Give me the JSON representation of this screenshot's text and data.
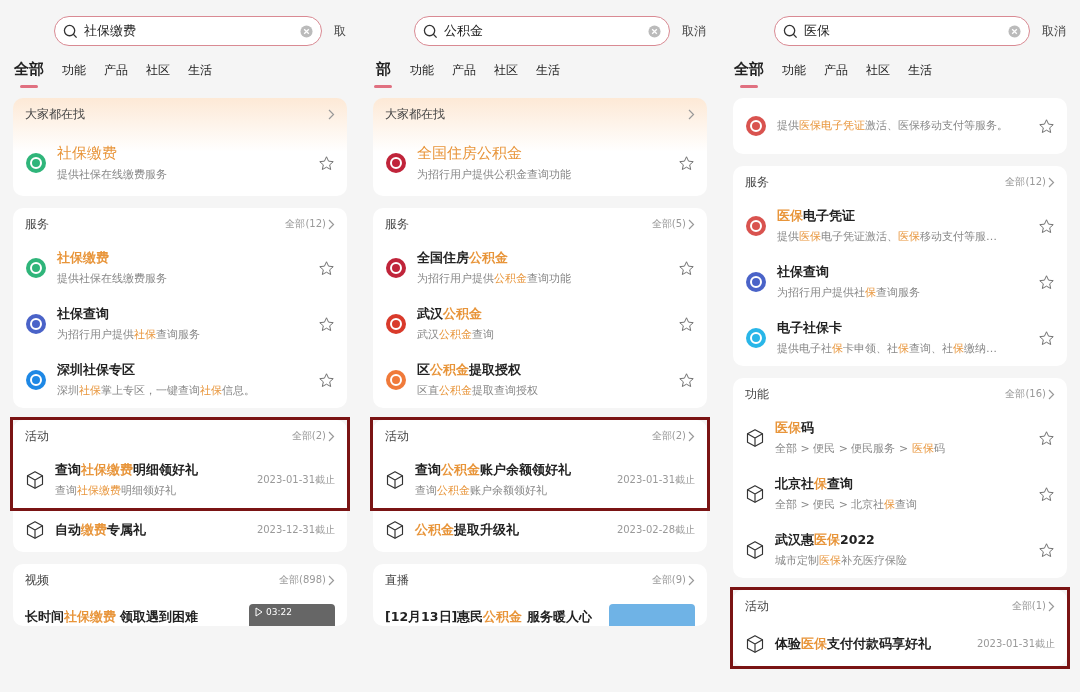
{
  "panels": [
    {
      "search": {
        "value": "社保缴费"
      },
      "cancel": "取",
      "tabs": [
        {
          "label": "全部",
          "selected": true
        },
        {
          "label": "功能",
          "selected": false
        },
        {
          "label": "产品",
          "selected": false
        },
        {
          "label": "社区",
          "selected": false
        },
        {
          "label": "生活",
          "selected": false
        }
      ],
      "sections": [
        {
          "kind": "featured",
          "header": "大家都在找",
          "boxed": false,
          "rows": [
            {
              "kind": "service",
              "color": "#2fb57a",
              "title": [
                {
                  "t": "社保缴费",
                  "highlight": true
                }
              ],
              "desc": [
                {
                  "t": "提供社保在线缴费服务",
                  "highlight": false
                }
              ]
            }
          ]
        },
        {
          "kind": "list",
          "header": "服务",
          "more": "全部(12)",
          "boxed": false,
          "rows": [
            {
              "kind": "service",
              "color": "#2fb57a",
              "title": [
                {
                  "t": "社保缴费",
                  "highlight": true
                }
              ],
              "desc": [
                {
                  "t": "提供社保在线缴费服务",
                  "highlight": false
                }
              ]
            },
            {
              "kind": "service",
              "color": "#4a63c8",
              "title": [
                {
                  "t": "社保查询",
                  "highlight": false
                }
              ],
              "desc": [
                {
                  "t": "为招行用户提供",
                  "highlight": false
                },
                {
                  "t": "社保",
                  "highlight": true
                },
                {
                  "t": "查询服务",
                  "highlight": false
                }
              ]
            },
            {
              "kind": "service",
              "color": "#1e88e5",
              "title": [
                {
                  "t": "深圳社保专区",
                  "highlight": false
                }
              ],
              "desc": [
                {
                  "t": "深圳",
                  "highlight": false
                },
                {
                  "t": "社保",
                  "highlight": true
                },
                {
                  "t": "掌上专区，一键查询",
                  "highlight": false
                },
                {
                  "t": "社保",
                  "highlight": true
                },
                {
                  "t": "信息。",
                  "highlight": false
                }
              ]
            }
          ]
        },
        {
          "kind": "list",
          "header": "活动",
          "more": "全部(2)",
          "boxed": true,
          "rows": [
            {
              "kind": "activity",
              "boxed": true,
              "date": "2023-01-31截止",
              "title": [
                {
                  "t": "查询",
                  "highlight": false
                },
                {
                  "t": "社保缴费",
                  "highlight": true
                },
                {
                  "t": "明细领好礼",
                  "highlight": false
                }
              ],
              "desc": [
                {
                  "t": "查询",
                  "highlight": false
                },
                {
                  "t": "社保缴费",
                  "highlight": true
                },
                {
                  "t": "明细领好礼",
                  "highlight": false
                }
              ]
            },
            {
              "kind": "activity",
              "boxed": false,
              "date": "2023-12-31截止",
              "title": [
                {
                  "t": "自动",
                  "highlight": false
                },
                {
                  "t": "缴费",
                  "highlight": true
                },
                {
                  "t": "专属礼",
                  "highlight": false
                }
              ]
            }
          ]
        },
        {
          "kind": "list",
          "header": "视频",
          "more": "全部(898)",
          "boxed": false,
          "rows": [
            {
              "kind": "media",
              "duration": "03:22",
              "title": [
                {
                  "t": "长时间",
                  "highlight": false
                },
                {
                  "t": "社保缴费",
                  "highlight": true
                },
                {
                  "t": " 领取遇到困难",
                  "highlight": false
                }
              ]
            }
          ]
        }
      ]
    },
    {
      "search": {
        "value": "公积金"
      },
      "cancel": "取消",
      "tabs": [
        {
          "label": "部",
          "selected": true
        },
        {
          "label": "功能",
          "selected": false
        },
        {
          "label": "产品",
          "selected": false
        },
        {
          "label": "社区",
          "selected": false
        },
        {
          "label": "生活",
          "selected": false
        }
      ],
      "sections": [
        {
          "kind": "featured",
          "header": "大家都在找",
          "boxed": false,
          "rows": [
            {
              "kind": "service",
              "color": "#c0243a",
              "title": [
                {
                  "t": "全国住房公积金",
                  "highlight": true
                }
              ],
              "desc": [
                {
                  "t": "为招行用户提供公积金查询功能",
                  "highlight": false
                }
              ]
            }
          ]
        },
        {
          "kind": "list",
          "header": "服务",
          "more": "全部(5)",
          "boxed": false,
          "rows": [
            {
              "kind": "service",
              "color": "#c0243a",
              "title": [
                {
                  "t": "全国住房",
                  "highlight": false
                },
                {
                  "t": "公积金",
                  "highlight": true
                }
              ],
              "desc": [
                {
                  "t": "为招行用户提供",
                  "highlight": false
                },
                {
                  "t": "公积金",
                  "highlight": true
                },
                {
                  "t": "查询功能",
                  "highlight": false
                }
              ]
            },
            {
              "kind": "service",
              "color": "#d93a2b",
              "title": [
                {
                  "t": "武汉",
                  "highlight": false
                },
                {
                  "t": "公积金",
                  "highlight": true
                }
              ],
              "desc": [
                {
                  "t": "武汉",
                  "highlight": false
                },
                {
                  "t": "公积金",
                  "highlight": true
                },
                {
                  "t": "查询",
                  "highlight": false
                }
              ]
            },
            {
              "kind": "service",
              "color": "#f07a3a",
              "title": [
                {
                  "t": "区",
                  "highlight": false
                },
                {
                  "t": "公积金",
                  "highlight": true
                },
                {
                  "t": "提取授权",
                  "highlight": false
                }
              ],
              "desc": [
                {
                  "t": "区直",
                  "highlight": false
                },
                {
                  "t": "公积金",
                  "highlight": true
                },
                {
                  "t": "提取查询授权",
                  "highlight": false
                }
              ]
            }
          ]
        },
        {
          "kind": "list",
          "header": "活动",
          "more": "全部(2)",
          "boxed": true,
          "rows": [
            {
              "kind": "activity",
              "boxed": true,
              "date": "2023-01-31截止",
              "title": [
                {
                  "t": "查询",
                  "highlight": false
                },
                {
                  "t": "公积金",
                  "highlight": true
                },
                {
                  "t": "账户余额领好礼",
                  "highlight": false
                }
              ],
              "desc": [
                {
                  "t": "查询",
                  "highlight": false
                },
                {
                  "t": "公积金",
                  "highlight": true
                },
                {
                  "t": "账户余额领好礼",
                  "highlight": false
                }
              ]
            },
            {
              "kind": "activity",
              "boxed": false,
              "date": "2023-02-28截止",
              "title": [
                {
                  "t": "公积金",
                  "highlight": true
                },
                {
                  "t": "提取升级礼",
                  "highlight": false
                }
              ]
            }
          ]
        },
        {
          "kind": "list",
          "header": "直播",
          "more": "全部(9)",
          "boxed": false,
          "rows": [
            {
              "kind": "media",
              "title": [
                {
                  "t": "[12月13日]惠民",
                  "highlight": false
                },
                {
                  "t": "公积金",
                  "highlight": true
                },
                {
                  "t": " 服务暖人心",
                  "highlight": false
                }
              ]
            }
          ]
        }
      ]
    },
    {
      "search": {
        "value": "医保"
      },
      "cancel": "取消",
      "tabs": [
        {
          "label": "全部",
          "selected": true
        },
        {
          "label": "功能",
          "selected": false
        },
        {
          "label": "产品",
          "selected": false
        },
        {
          "label": "社区",
          "selected": false
        },
        {
          "label": "生活",
          "selected": false
        }
      ],
      "sections": [
        {
          "kind": "list",
          "boxed": false,
          "rows": [
            {
              "kind": "service",
              "color": "#d9534f",
              "desc": [
                {
                  "t": "提供",
                  "highlight": false
                },
                {
                  "t": "医保电子凭证",
                  "highlight": true
                },
                {
                  "t": "激活、医保移动支付等服务。",
                  "highlight": false
                }
              ]
            }
          ]
        },
        {
          "kind": "list",
          "header": "服务",
          "more": "全部(12)",
          "boxed": false,
          "rows": [
            {
              "kind": "service",
              "color": "#d9534f",
              "title": [
                {
                  "t": "医保",
                  "highlight": true
                },
                {
                  "t": "电子凭证",
                  "highlight": false
                }
              ],
              "desc": [
                {
                  "t": "提供",
                  "highlight": false
                },
                {
                  "t": "医保",
                  "highlight": true
                },
                {
                  "t": "电子凭证激活、",
                  "highlight": false
                },
                {
                  "t": "医保",
                  "highlight": true
                },
                {
                  "t": "移动支付等服…",
                  "highlight": false
                }
              ]
            },
            {
              "kind": "service",
              "color": "#4a63c8",
              "title": [
                {
                  "t": "社保查询",
                  "highlight": false
                }
              ],
              "desc": [
                {
                  "t": "为招行用户提供社",
                  "highlight": false
                },
                {
                  "t": "保",
                  "highlight": true
                },
                {
                  "t": "查询服务",
                  "highlight": false
                }
              ]
            },
            {
              "kind": "service",
              "color": "#29b6e8",
              "title": [
                {
                  "t": "电子社保卡",
                  "highlight": false
                }
              ],
              "desc": [
                {
                  "t": "提供电子社",
                  "highlight": false
                },
                {
                  "t": "保",
                  "highlight": true
                },
                {
                  "t": "卡申领、社",
                  "highlight": false
                },
                {
                  "t": "保",
                  "highlight": true
                },
                {
                  "t": "查询、社",
                  "highlight": false
                },
                {
                  "t": "保",
                  "highlight": true
                },
                {
                  "t": "缴纳…",
                  "highlight": false
                }
              ]
            }
          ]
        },
        {
          "kind": "list",
          "header": "功能",
          "more": "全部(16)",
          "boxed": false,
          "rows": [
            {
              "kind": "function",
              "title": [
                {
                  "t": "医保",
                  "highlight": true
                },
                {
                  "t": "码",
                  "highlight": false
                }
              ],
              "desc": [
                {
                  "t": "全部 > 便民 > 便民服务 > ",
                  "highlight": false
                },
                {
                  "t": "医保",
                  "highlight": true
                },
                {
                  "t": "码",
                  "highlight": false
                }
              ]
            },
            {
              "kind": "function",
              "title": [
                {
                  "t": "北京社",
                  "highlight": false
                },
                {
                  "t": "保",
                  "highlight": true
                },
                {
                  "t": "查询",
                  "highlight": false
                }
              ],
              "desc": [
                {
                  "t": "全部 > 便民 > 北京社",
                  "highlight": false
                },
                {
                  "t": "保",
                  "highlight": true
                },
                {
                  "t": "查询",
                  "highlight": false
                }
              ]
            },
            {
              "kind": "function",
              "title": [
                {
                  "t": "武汉惠",
                  "highlight": false
                },
                {
                  "t": "医保",
                  "highlight": true
                },
                {
                  "t": "2022",
                  "highlight": false
                }
              ],
              "desc": [
                {
                  "t": "城市定制",
                  "highlight": false
                },
                {
                  "t": "医保",
                  "highlight": true
                },
                {
                  "t": "补充医疗保险",
                  "highlight": false
                }
              ]
            }
          ]
        },
        {
          "kind": "list",
          "header": "活动",
          "more": "全部(1)",
          "boxed": true,
          "rows": [
            {
              "kind": "activity",
              "boxed": true,
              "date": "2023-01-31截止",
              "title": [
                {
                  "t": "体验",
                  "highlight": false
                },
                {
                  "t": "医保",
                  "highlight": true
                },
                {
                  "t": "支付付款码享好礼",
                  "highlight": false
                }
              ]
            }
          ]
        }
      ]
    }
  ]
}
